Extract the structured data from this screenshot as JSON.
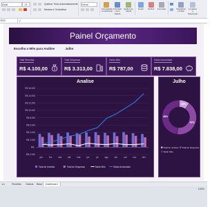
{
  "ribbon": {
    "font_name": "Arial",
    "font_size": "11",
    "wrap_label": "Quebrar Texto Automaticamente",
    "merge_label": "Mesclar e Centralizar",
    "number_format": "Geral",
    "buttons": [
      "Formatação Condicional",
      "Formatar como Tabela",
      "Estilos de Célula",
      "Inserir",
      "Excluir",
      "Formatar",
      "Classificar e Filtrar",
      "Localizar e Selecionar"
    ]
  },
  "formula_bar": {
    "name_box": "P21"
  },
  "dashboard": {
    "title": "Painel Orçamento",
    "selector_label": "Escolha o Mês para Análise",
    "selected_month": "Julho"
  },
  "cards": [
    {
      "label": "Total Receitas",
      "value": "R$ 4.100,00",
      "icon": "money-bag-icon"
    },
    {
      "label": "Total Despesas",
      "value": "R$ 3.313,00",
      "icon": "receipt-bottle-icon"
    },
    {
      "label": "Saldo Mês",
      "value": "R$ 787,00",
      "icon": "coins-stack-icon"
    },
    {
      "label": "Saldo Acumulado",
      "value": "R$ 7.838,00",
      "icon": "piggy-bank-icon"
    }
  ],
  "chart_data": [
    {
      "type": "bar",
      "title": "Analise",
      "categories": [
        "jan",
        "fev",
        "mar",
        "abr",
        "mai",
        "jun",
        "jul",
        "ago",
        "set",
        "out",
        "nov",
        "dez"
      ],
      "ylim": [
        -2000,
        16000
      ],
      "y_ticks": [
        "R$ 16.000",
        "R$ 14.000",
        "R$ 12.000",
        "R$ 10.000",
        "R$ 8.000",
        "R$ 6.000",
        "R$ 4.000",
        "R$ 2.000",
        "R$ -",
        "-R$ 2.000"
      ],
      "series": [
        {
          "name": "Total de receitas",
          "kind": "bar",
          "color": "#6b6fd6",
          "values": [
            3600,
            3900,
            3700,
            4000,
            3800,
            4000,
            4100,
            3900,
            4000,
            4100,
            3800,
            3600
          ]
        },
        {
          "name": "Total de Despesas",
          "kind": "bar",
          "color": "#b86bb0",
          "values": [
            2800,
            3300,
            3000,
            3100,
            3400,
            2900,
            3313,
            3200,
            3000,
            3400,
            3100,
            2700
          ]
        },
        {
          "name": "Saldo Mês",
          "kind": "line",
          "color": "#ffffff",
          "values": [
            800,
            600,
            700,
            900,
            400,
            1100,
            787,
            700,
            1000,
            700,
            700,
            900
          ]
        },
        {
          "name": "Saldo Acumulado",
          "kind": "line",
          "color": "#2f7fe0",
          "values": [
            800,
            1400,
            2100,
            3000,
            3400,
            4500,
            5300,
            7838,
            9000,
            10600,
            12200,
            14600
          ]
        }
      ],
      "legend": "bottom"
    },
    {
      "type": "pie",
      "title": "Julho",
      "donut": true,
      "slices": [
        {
          "label": "Total de receitas",
          "value": 10,
          "display": "10%",
          "color": "#c9a4d8"
        },
        {
          "label": "Total de Despesas",
          "value": 42,
          "display": "42%",
          "color": "#8f4aa6"
        },
        {
          "label": "Saldo Mês",
          "value": 48,
          "display": "48%",
          "color": "#6a2a86"
        }
      ],
      "legend": "bottom"
    }
  ],
  "sheet_tabs": [
    "Receitas",
    "Gastos",
    "Base",
    "Dashboard"
  ],
  "active_tab": "Dashboard",
  "status": {
    "zoom": "100%"
  }
}
